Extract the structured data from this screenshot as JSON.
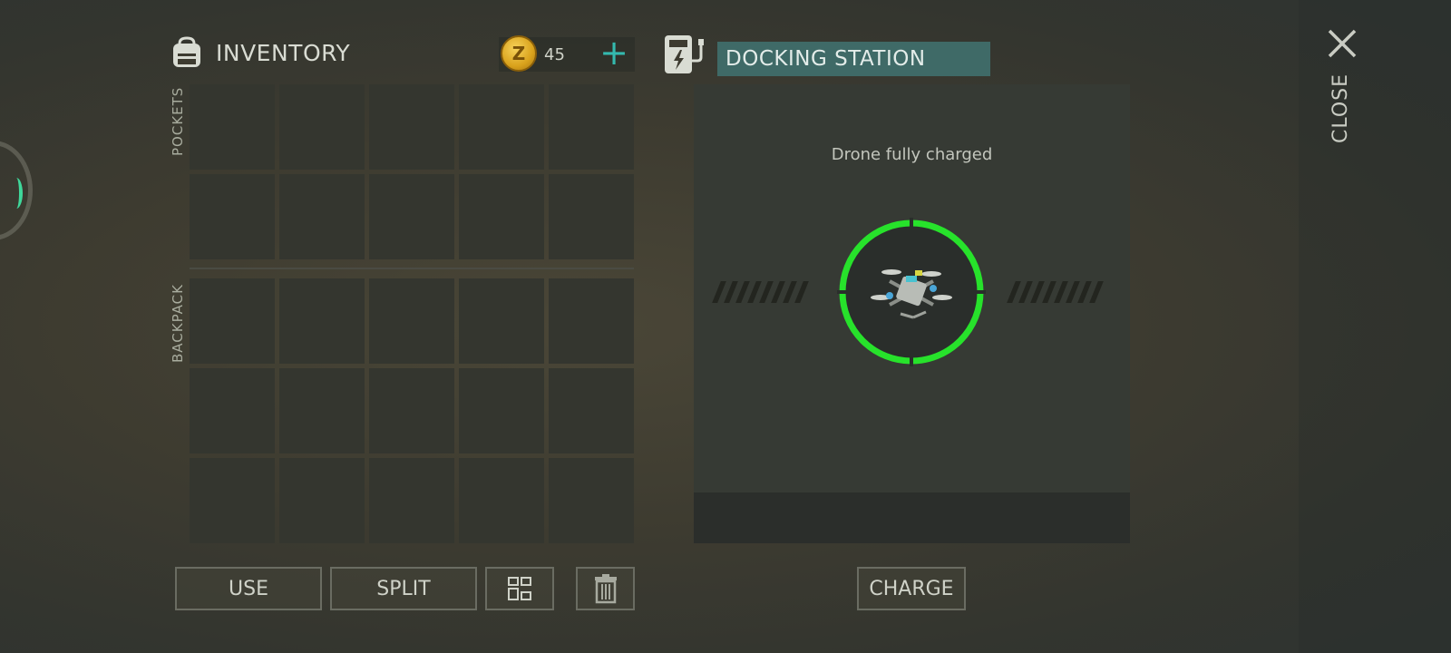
{
  "inventory": {
    "title": "INVENTORY",
    "currency_count": "45",
    "currency_symbol": "Z",
    "add_label": "+",
    "sections": {
      "pockets": "POCKETS",
      "backpack": "BACKPACK"
    }
  },
  "actions": {
    "use": "USE",
    "split": "SPLIT",
    "sort_icon": "grid-sort-icon",
    "trash_icon": "trash-icon"
  },
  "docking": {
    "title": "DOCKING STATION",
    "status": "Drone fully charged",
    "charge_button": "CHARGE",
    "charge_ring_color": "#27e22b",
    "header_color": "#3f6a67"
  },
  "close": {
    "label": "CLOSE"
  },
  "colors": {
    "accent": "#34b9ae",
    "coin": "#e2ab24"
  }
}
